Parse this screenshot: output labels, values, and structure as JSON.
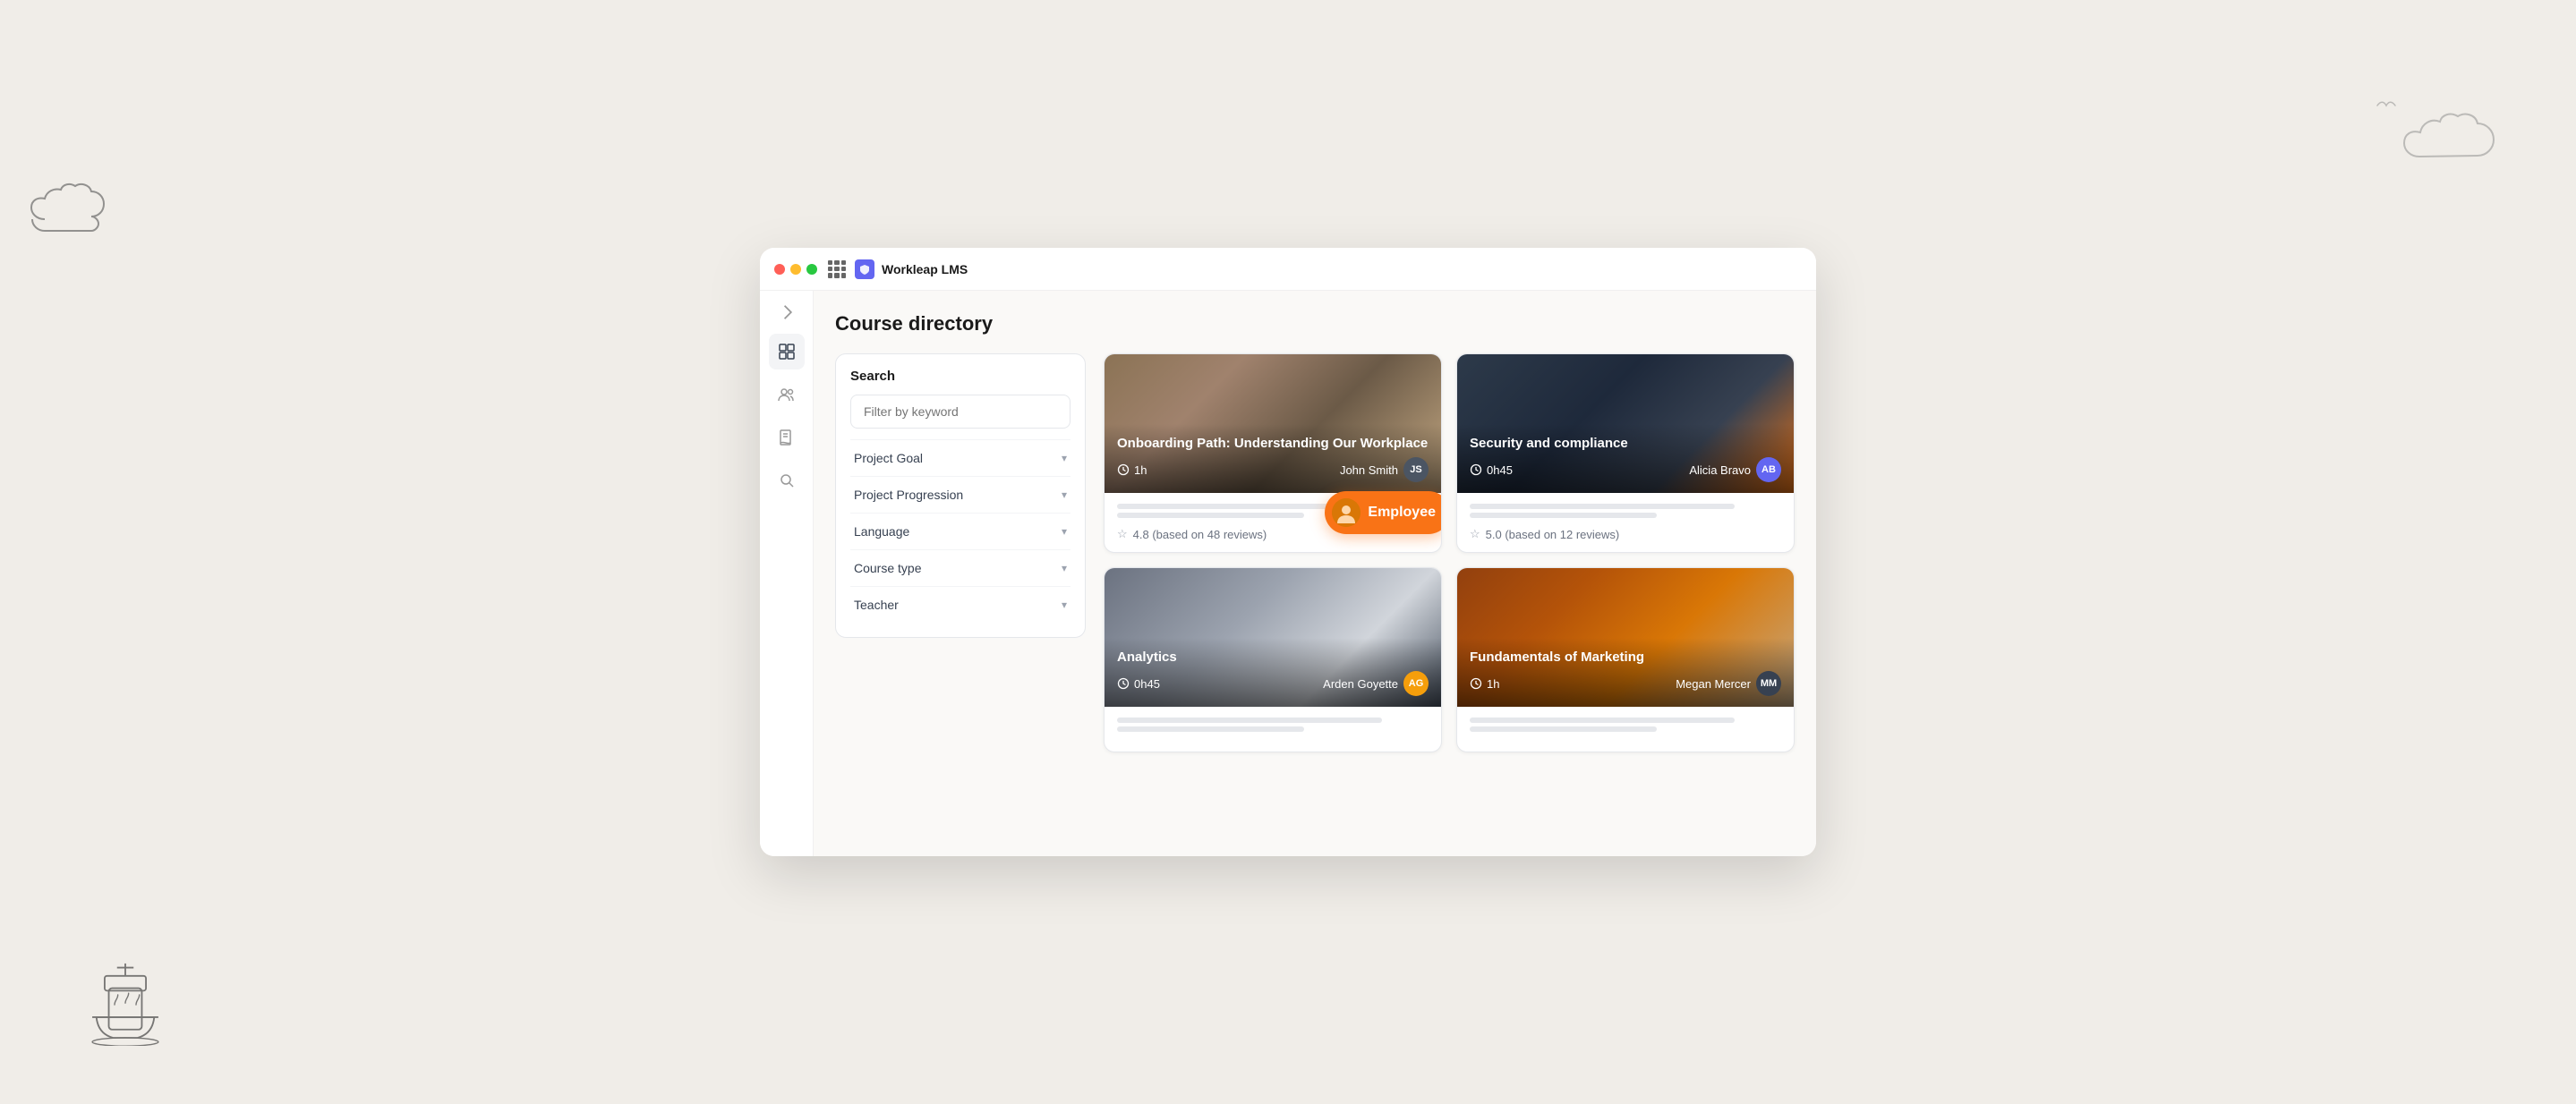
{
  "app": {
    "title": "Workleap LMS"
  },
  "page": {
    "title": "Course directory"
  },
  "sidebar": {
    "items": [
      {
        "name": "grid",
        "label": "Grid"
      },
      {
        "name": "users",
        "label": "Users"
      },
      {
        "name": "book",
        "label": "Book"
      },
      {
        "name": "search",
        "label": "Search"
      }
    ]
  },
  "filter": {
    "section_title": "Search",
    "keyword_placeholder": "Filter by keyword",
    "items": [
      {
        "label": "Project Goal"
      },
      {
        "label": "Project Progression"
      },
      {
        "label": "Language"
      },
      {
        "label": "Course type"
      },
      {
        "label": "Teacher"
      }
    ]
  },
  "courses": [
    {
      "id": 1,
      "title": "Onboarding Path: Understanding Our Workplace",
      "duration": "1h",
      "teacher": "John Smith",
      "teacher_initials": "JS",
      "avatar_class": "avatar-js",
      "rating": "4.8 (based on 48 reviews)",
      "image_class": "img-onboarding"
    },
    {
      "id": 2,
      "title": "Security and compliance",
      "duration": "0h45",
      "teacher": "Alicia Bravo",
      "teacher_initials": "AB",
      "avatar_class": "avatar-ab",
      "rating": "5.0 (based on 12 reviews)",
      "image_class": "img-security"
    },
    {
      "id": 3,
      "title": "Analytics",
      "duration": "0h45",
      "teacher": "Arden Goyette",
      "teacher_initials": "AG",
      "avatar_class": "avatar-ag",
      "rating": "",
      "image_class": "img-analytics"
    },
    {
      "id": 4,
      "title": "Fundamentals of Marketing",
      "duration": "1h",
      "teacher": "Megan Mercer",
      "teacher_initials": "MM",
      "avatar_class": "avatar-mm",
      "rating": "",
      "image_class": "img-marketing"
    }
  ],
  "tooltip": {
    "label": "Employee"
  }
}
